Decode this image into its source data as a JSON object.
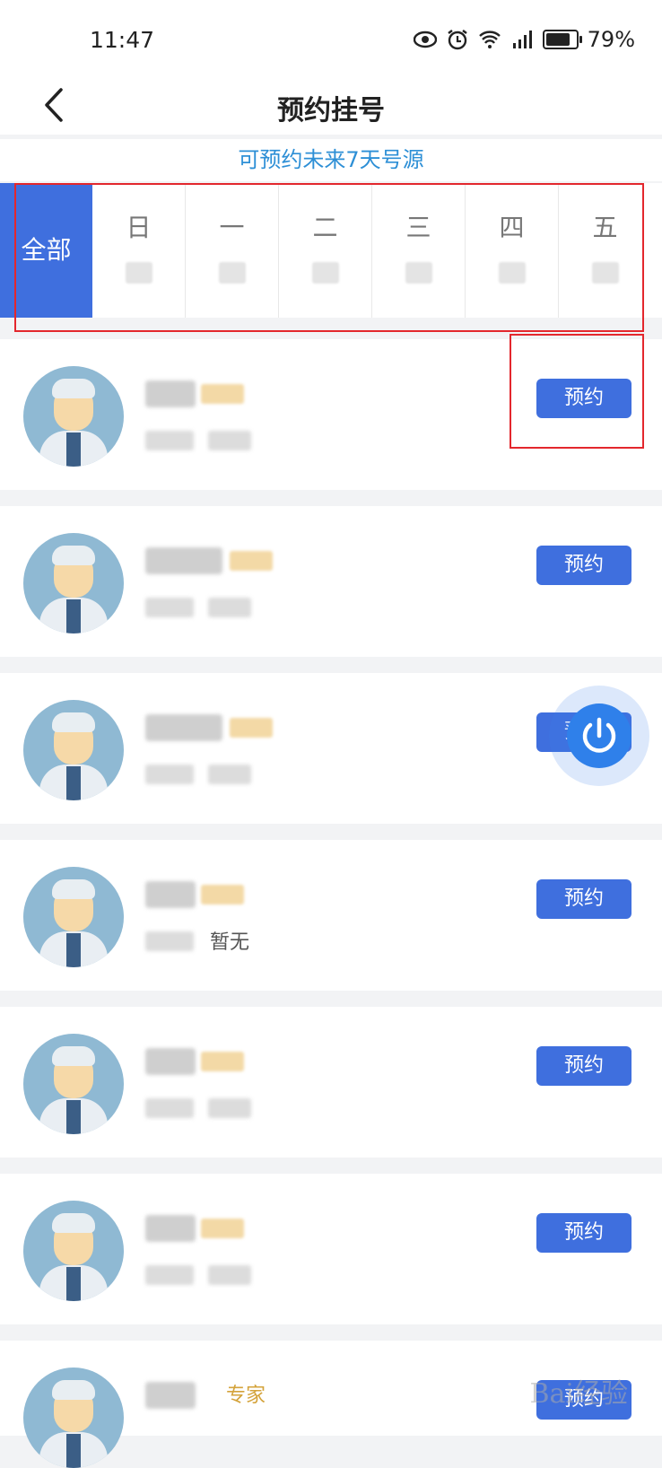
{
  "status": {
    "time": "11:47",
    "battery": "79%"
  },
  "header": {
    "title": "预约挂号"
  },
  "notice": "可预约未来7天号源",
  "days": {
    "all_label": "全部",
    "weekdays": [
      "日",
      "一",
      "二",
      "三",
      "四",
      "五"
    ]
  },
  "doctors": [
    {
      "button": "预约"
    },
    {
      "button": "预约"
    },
    {
      "button": "预约"
    },
    {
      "button": "预约",
      "sub_text": "暂无"
    },
    {
      "button": "预约"
    },
    {
      "button": "预约"
    },
    {
      "button": "预约",
      "tag_text": "专家"
    }
  ],
  "colors": {
    "accent": "#3f6fde",
    "tag": "#d4a33b",
    "notice": "#2d8fd6",
    "highlight": "#e3272d"
  },
  "watermark": "Bai经验"
}
